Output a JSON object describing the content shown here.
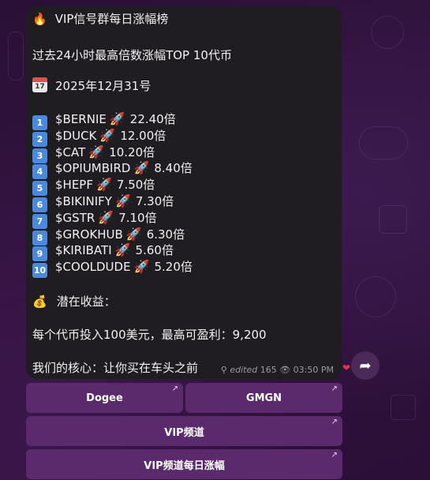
{
  "message": {
    "title": "VIP信号群每日涨幅榜",
    "subtitle": "过去24小时最高倍数涨幅TOP 10代币",
    "date": "2025年12月31号",
    "calendar_day": "17",
    "ranking": [
      {
        "rank_icon": "1",
        "token": "$BERNIE",
        "gain": "22.40倍"
      },
      {
        "rank_icon": "2",
        "token": "$DUCK",
        "gain": "12.00倍"
      },
      {
        "rank_icon": "3",
        "token": "$CAT",
        "gain": "10.20倍"
      },
      {
        "rank_icon": "4",
        "token": "$OPIUMBIRD",
        "gain": "8.40倍"
      },
      {
        "rank_icon": "5",
        "token": "$HEPF",
        "gain": "7.50倍"
      },
      {
        "rank_icon": "6",
        "token": "$BIKINIFY",
        "gain": "7.30倍"
      },
      {
        "rank_icon": "7",
        "token": "$GSTR",
        "gain": "7.10倍"
      },
      {
        "rank_icon": "8",
        "token": "$GROKHUB",
        "gain": "6.30倍"
      },
      {
        "rank_icon": "9",
        "token": "$KIRIBATI",
        "gain": "5.60倍"
      },
      {
        "rank_icon": "10",
        "token": "$COOLDUDE",
        "gain": "5.20倍"
      }
    ],
    "potential_label": "潜在收益：",
    "potential_text": "每个代币投入100美元，最高可盈利：9,200",
    "core_text": "我们的核心：让你买在车头之前",
    "edited_label": "edited",
    "views": "165",
    "time": "03:50 PM"
  },
  "buttons": {
    "dogee": "Dogee",
    "gmgn": "GMGN",
    "vip_channel": "VIP频道",
    "vip_daily": "VIP频道每日涨幅"
  },
  "colors": {
    "bubble": "#1f1c22",
    "button": "#5a2a6c",
    "keycap": "#4a89dc",
    "background": "#2a1036"
  },
  "icons": [
    "fire-icon",
    "calendar-icon",
    "keycap-number-icon",
    "rocket-icon",
    "money-bag-icon",
    "pin-icon",
    "eye-icon",
    "heart-icon",
    "share-arrow-icon",
    "external-link-arrow-icon"
  ]
}
